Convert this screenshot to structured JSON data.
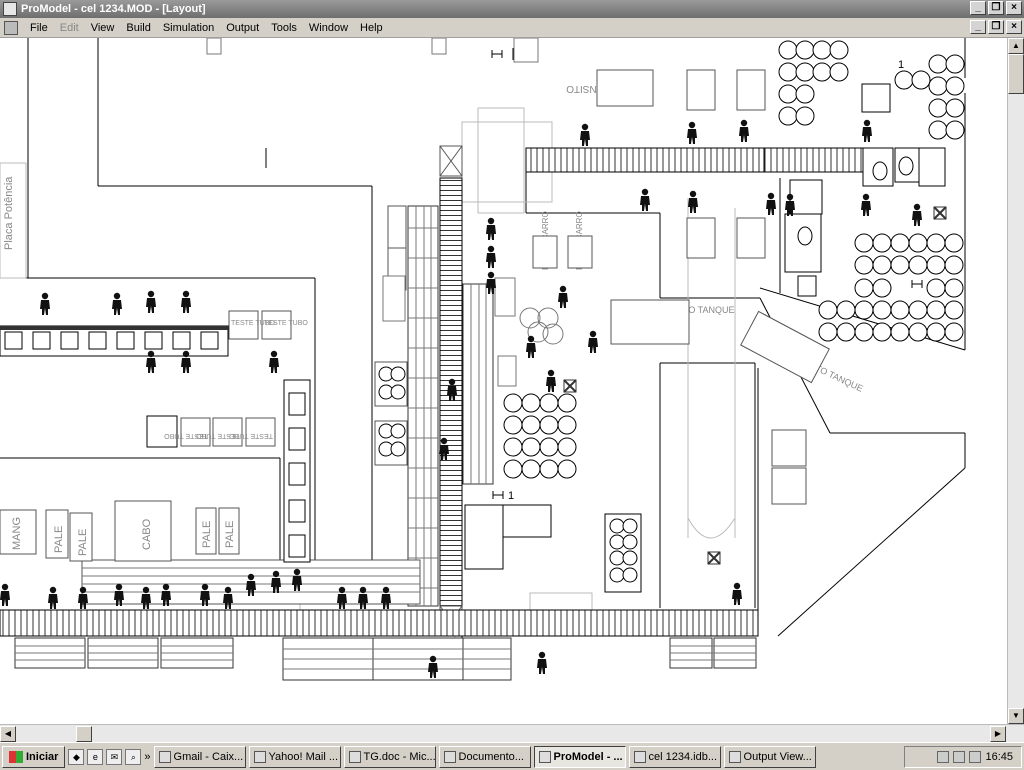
{
  "window": {
    "title": "ProModel - cel 1234.MOD - [Layout]"
  },
  "menu": [
    "File",
    "Edit",
    "View",
    "Build",
    "Simulation",
    "Output",
    "Tools",
    "Window",
    "Help"
  ],
  "menu_disabled": [
    "Edit"
  ],
  "layout": {
    "labels": {
      "placa_potencia": "Placa Potência",
      "palet_transito": "PALET TRÂNSITO",
      "carrinho_cesto_tanque": "CARRINHO CESTO TANQUE",
      "teste_tubo": "TESTE TUBO",
      "teste_tubo_rot": "TESTE TUBO",
      "mang": "MANG",
      "pale": "PALE",
      "cabo": "CABO",
      "painel_carro": "PAINEL CARRO",
      "counter_1": "1"
    },
    "icons": [
      "operator-icon",
      "queue-icon",
      "node-icon",
      "cross-box-icon"
    ]
  },
  "taskbar": {
    "start": "Iniciar",
    "tasks": [
      "Gmail - Caix...",
      "Yahoo! Mail ...",
      "TG.doc - Mic...",
      "Documento...",
      "ProModel - ...",
      "cel 1234.idb...",
      "Output View..."
    ],
    "active_task": "ProModel - ...",
    "clock": "16:45"
  }
}
